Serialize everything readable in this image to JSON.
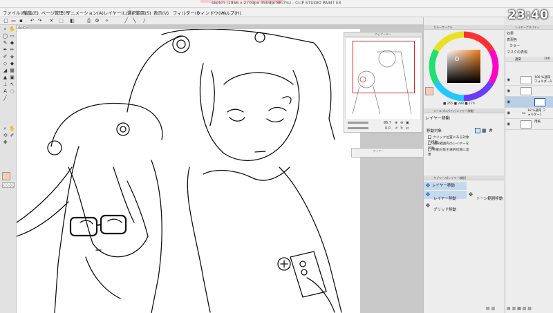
{
  "window": {
    "title": "sketch (1966 x 2709px 350dpi 86.7%) - CLIP STUDIO PAINT EX"
  },
  "clock": "23:40",
  "menu": [
    "ファイル(F)",
    "編集(E)",
    "ページ管理(P)",
    "アニメーション(A)",
    "レイヤー(L)",
    "選択範囲(S)",
    "表示(V)",
    "フィルター(I)",
    "ウィンドウ(W)",
    "ヘルプ(H)"
  ],
  "canvas": {
    "tab_label": "sketch"
  },
  "navigator": {
    "title": "ナビゲーター",
    "zoom": "86.7",
    "rotate": "0.0"
  },
  "color_panel": {
    "title": "カラーサークル",
    "h": "255",
    "s": "288",
    "v": "170"
  },
  "tool_property": {
    "header": "ツールプロパティ[レイヤー移動]",
    "title": "レイヤー移動",
    "label": "移動対象",
    "options": [
      "クリック位置にある対象を移動",
      "選択範囲内のレイヤーを移動",
      "移動対象を選択状態に変更"
    ]
  },
  "sub_tool": {
    "header": "サブツール[レイヤー移動]",
    "items": [
      "レイヤー移動",
      "レイヤー移動",
      "トーン範囲移動",
      "グリッド移動"
    ]
  },
  "floating_bar": {
    "title": "クイアー"
  },
  "layer_panel": {
    "title": "レイヤープロパティ",
    "blend_label": "効果",
    "tone_label": "表現色",
    "color_label": "カラー",
    "mask_label": "マスクの表現",
    "mode": "通常",
    "opacity": "100",
    "layers": [
      {
        "name": "100 %通常 フォルダー1",
        "selected": false
      },
      {
        "name": "",
        "selected": false
      },
      {
        "name": "",
        "selected": true
      },
      {
        "name": "18 %通常 フォルダー1",
        "selected": false
      },
      {
        "name": "用紙",
        "selected": false
      }
    ]
  },
  "accent_color": "#f7cbb4"
}
